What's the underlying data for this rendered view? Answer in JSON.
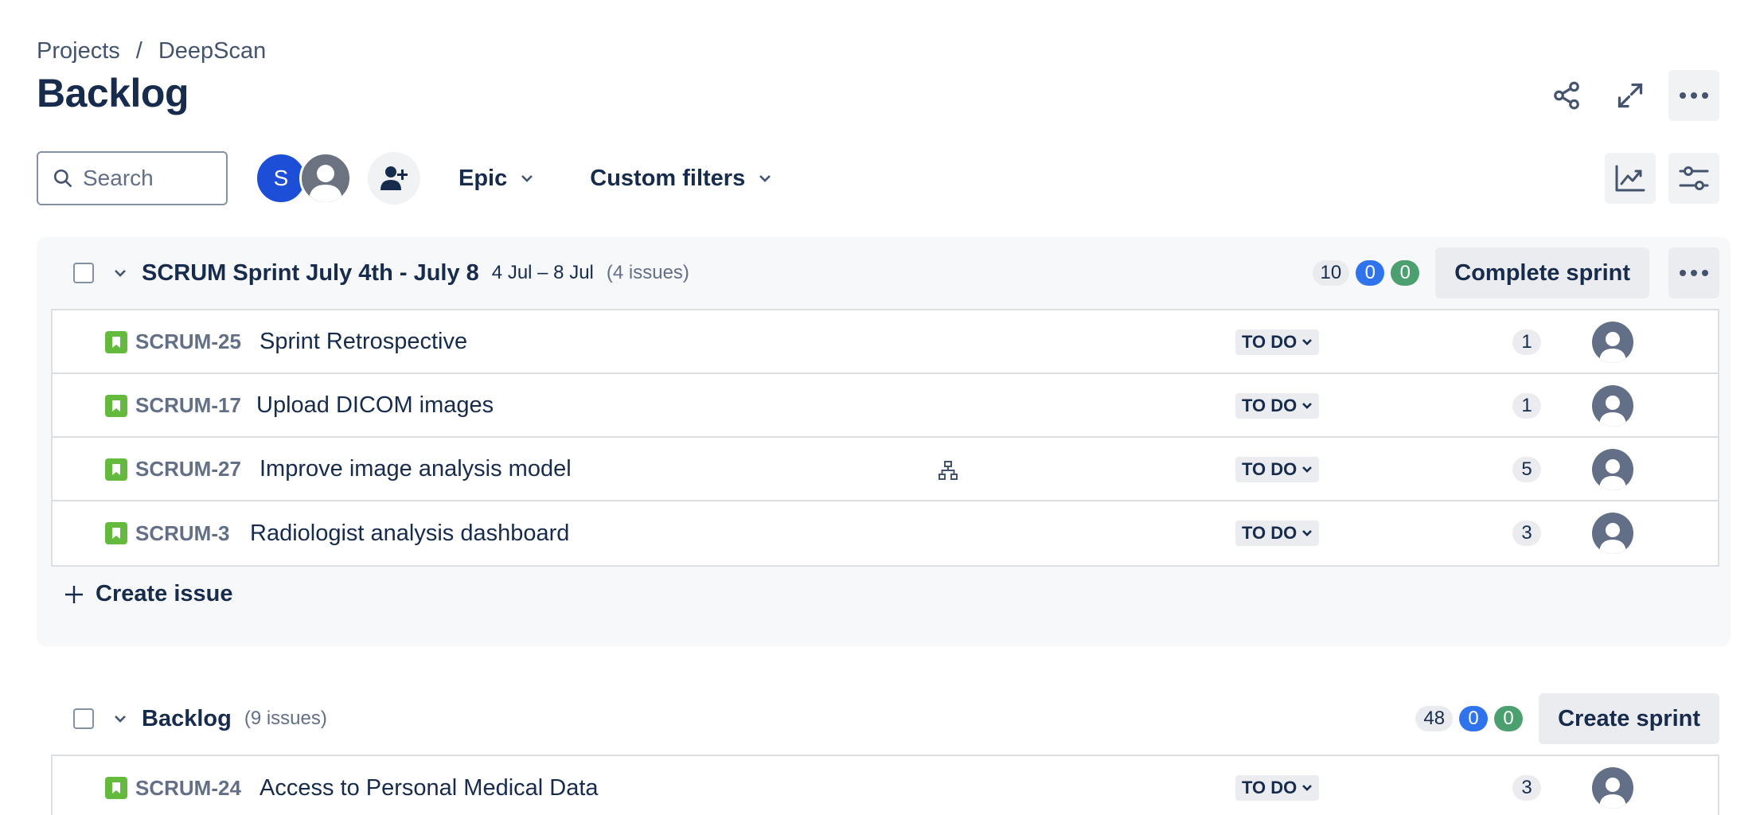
{
  "breadcrumb": {
    "items": [
      "Projects",
      "DeepScan"
    ],
    "separator": "/"
  },
  "page": {
    "title": "Backlog"
  },
  "top_actions": {
    "share_icon": "share-icon",
    "fullscreen_icon": "expand-icon",
    "more_icon": "more-icon"
  },
  "toolbar": {
    "search_placeholder": "Search",
    "avatar_initial": "S",
    "filters": {
      "epic": "Epic",
      "custom": "Custom filters"
    },
    "right_icons": [
      "insights-icon",
      "view-settings-icon"
    ]
  },
  "sprint": {
    "title": "SCRUM Sprint July 4th - July 8",
    "dates": "4 Jul – 8 Jul",
    "count": "(4 issues)",
    "points": {
      "todo": "10",
      "in_progress": "0",
      "done": "0"
    },
    "complete_label": "Complete sprint",
    "issues": [
      {
        "key": "SCRUM-25",
        "summary": "Sprint Retrospective",
        "status": "TO DO",
        "estimate": "1"
      },
      {
        "key": "SCRUM-17",
        "summary": "Upload DICOM images",
        "status": "TO DO",
        "estimate": "1"
      },
      {
        "key": "SCRUM-27",
        "summary": "Improve image analysis model",
        "status": "TO DO",
        "estimate": "5"
      },
      {
        "key": "SCRUM-3",
        "summary": "Radiologist analysis dashboard",
        "status": "TO DO",
        "estimate": "3"
      }
    ],
    "create_issue_label": "Create issue"
  },
  "backlog": {
    "title": "Backlog",
    "count": "(9 issues)",
    "points": {
      "todo": "48",
      "in_progress": "0",
      "done": "0"
    },
    "create_sprint_label": "Create sprint",
    "issues": [
      {
        "key": "SCRUM-24",
        "summary": "Access to Personal Medical Data",
        "status": "TO DO",
        "estimate": "3"
      }
    ]
  },
  "colors": {
    "accent_blue": "#1d4ed8",
    "story_green": "#63ba3c",
    "pill_blue": "#2f74ec",
    "pill_green": "#4c9f6e"
  }
}
